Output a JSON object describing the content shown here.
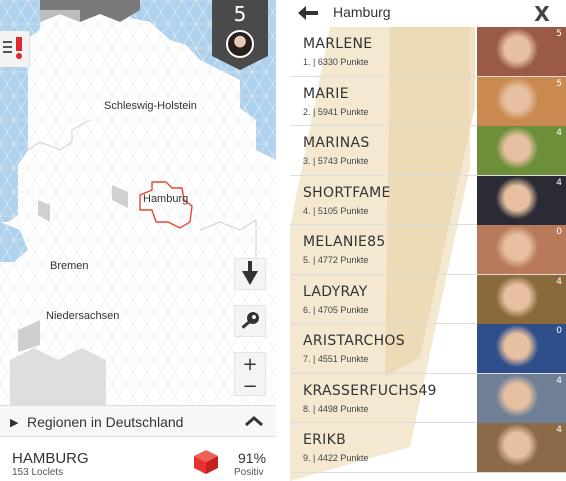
{
  "map_screen": {
    "score": "5",
    "labels": {
      "schleswig_holstein": "Schleswig-Holstein",
      "hamburg": "Hamburg",
      "bremen": "Bremen",
      "niedersachsen": "Niedersachsen"
    },
    "zoom_in": "+",
    "zoom_out": "−",
    "region_bar": {
      "label": "Regionen in Deutschland"
    },
    "status": {
      "city": "HAMBURG",
      "loclets": "153 Loclets",
      "percent": "91%",
      "positiv": "Positiv"
    },
    "icons": {
      "alert": "alert-icon",
      "compass": "compass-arrow-icon",
      "key": "key-icon",
      "play": "play-icon",
      "chevron": "chevron-up-icon",
      "cube": "cube-icon"
    },
    "colors": {
      "water": "#aed2ee",
      "land": "#ffffff",
      "highlight": "#e34a33",
      "alert": "#e0282f",
      "cube": "#e5312f"
    }
  },
  "leaderboard": {
    "title": "Hamburg",
    "close": "X",
    "rows": [
      {
        "name": "MARLENE",
        "meta": "1. | 6330 Punkte",
        "badge": "5",
        "photo_color": "#9a5a44"
      },
      {
        "name": "MARIE",
        "meta": "2. | 5941 Punkte",
        "badge": "5",
        "photo_color": "#c9894f"
      },
      {
        "name": "MARINAS",
        "meta": "3. | 5743 Punkte",
        "badge": "4",
        "photo_color": "#6d8f3a"
      },
      {
        "name": "SHORTFAME",
        "meta": "4. | 5105 Punkte",
        "badge": "4",
        "photo_color": "#2b2b35"
      },
      {
        "name": "MELANIE85",
        "meta": "5. | 4772 Punkte",
        "badge": "0",
        "photo_color": "#b97a5c"
      },
      {
        "name": "LADYRAY",
        "meta": "6. | 4705 Punkte",
        "badge": "4",
        "photo_color": "#8a6a3a"
      },
      {
        "name": "ARISTARCHOS",
        "meta": "7. | 4551 Punkte",
        "badge": "0",
        "photo_color": "#2f4f8a"
      },
      {
        "name": "KRASSERFUCHS49",
        "meta": "8. | 4498 Punkte",
        "badge": "4",
        "photo_color": "#6f7f96"
      },
      {
        "name": "ERIKB",
        "meta": "9. | 4422 Punkte",
        "badge": "4",
        "photo_color": "#8b6b47"
      }
    ],
    "icons": {
      "back": "back-arrow-icon",
      "close": "close-icon"
    },
    "colors": {
      "accent": "#e8d3b0"
    }
  }
}
